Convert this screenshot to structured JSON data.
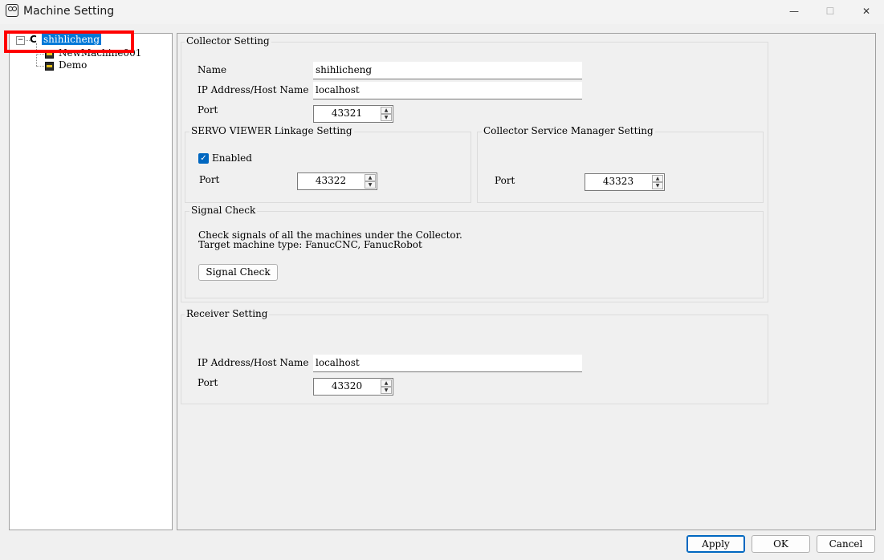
{
  "window": {
    "title": "Machine Setting",
    "minimize": "—",
    "maximize": "☐",
    "close": "✕"
  },
  "tree": {
    "root": {
      "label": "shihlicheng",
      "expander": "−",
      "icon_letter": "C"
    },
    "children": [
      {
        "label": "NewMachine001",
        "icon": "machine-icon"
      },
      {
        "label": "Demo",
        "icon": "machine-icon"
      }
    ],
    "highlight_color": "#ff0000",
    "selection_color": "#0078d7"
  },
  "collector": {
    "title": "Collector Setting",
    "name_label": "Name",
    "name_value": "shihlicheng",
    "ip_label": "IP Address/Host Name",
    "ip_value": "localhost",
    "port_label": "Port",
    "port_value": "43321"
  },
  "servo": {
    "title": "SERVO VIEWER Linkage Setting",
    "enabled_label": "Enabled",
    "enabled_checked": true,
    "port_label": "Port",
    "port_value": "43322"
  },
  "service_manager": {
    "title": "Collector Service Manager Setting",
    "port_label": "Port",
    "port_value": "43323"
  },
  "signal_check": {
    "title": "Signal Check",
    "desc_line1": "Check signals of all the machines under the Collector.",
    "desc_line2": "Target machine type: FanucCNC, FanucRobot",
    "button_label": "Signal Check"
  },
  "receiver": {
    "title": "Receiver Setting",
    "ip_label": "IP Address/Host Name",
    "ip_value": "localhost",
    "port_label": "Port",
    "port_value": "43320"
  },
  "footer": {
    "apply": "Apply",
    "ok": "OK",
    "cancel": "Cancel"
  }
}
